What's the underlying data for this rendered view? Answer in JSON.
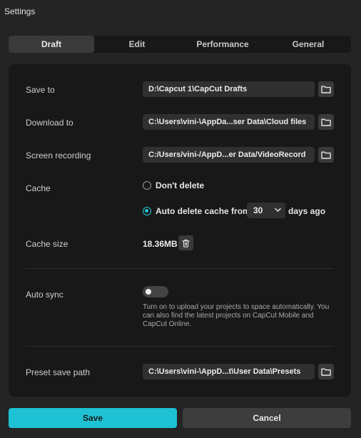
{
  "window": {
    "title": "Settings"
  },
  "tabs": [
    {
      "label": "Draft",
      "active": true
    },
    {
      "label": "Edit",
      "active": false
    },
    {
      "label": "Performance",
      "active": false
    },
    {
      "label": "General",
      "active": false
    }
  ],
  "draft": {
    "save_to": {
      "label": "Save to",
      "value": "D:\\Capcut 1\\CapCut Drafts",
      "button_icon": "folder-icon"
    },
    "download_to": {
      "label": "Download to",
      "value": "C:\\Users\\vini-\\AppDa...ser Data\\Cloud files",
      "button_icon": "folder-icon"
    },
    "screen_recording": {
      "label": "Screen recording",
      "value": "C:/Users/vini-/AppD...er Data/VideoRecord",
      "button_icon": "folder-icon"
    },
    "cache": {
      "label": "Cache",
      "option_dont_delete": "Don't delete",
      "option_auto_delete": "Auto delete cache from",
      "selected": "auto_delete",
      "days_value": "30",
      "days_suffix": "days ago"
    },
    "cache_size": {
      "label": "Cache size",
      "value": "18.36MB",
      "button_icon": "trash-icon"
    },
    "auto_sync": {
      "label": "Auto sync",
      "enabled": false,
      "help": "Turn on to upload your projects to space automatically. You can also find the latest projects on CapCut Mobile and CapCut Online."
    },
    "preset_save_path": {
      "label": "Preset save path",
      "value": "C:\\Users\\vini-\\AppD...t\\User Data\\Presets",
      "button_icon": "folder-icon"
    }
  },
  "footer": {
    "save_label": "Save",
    "cancel_label": "Cancel"
  },
  "colors": {
    "accent": "#1ec2d4",
    "panel": "#181818",
    "background": "#242424",
    "field": "#303030"
  }
}
